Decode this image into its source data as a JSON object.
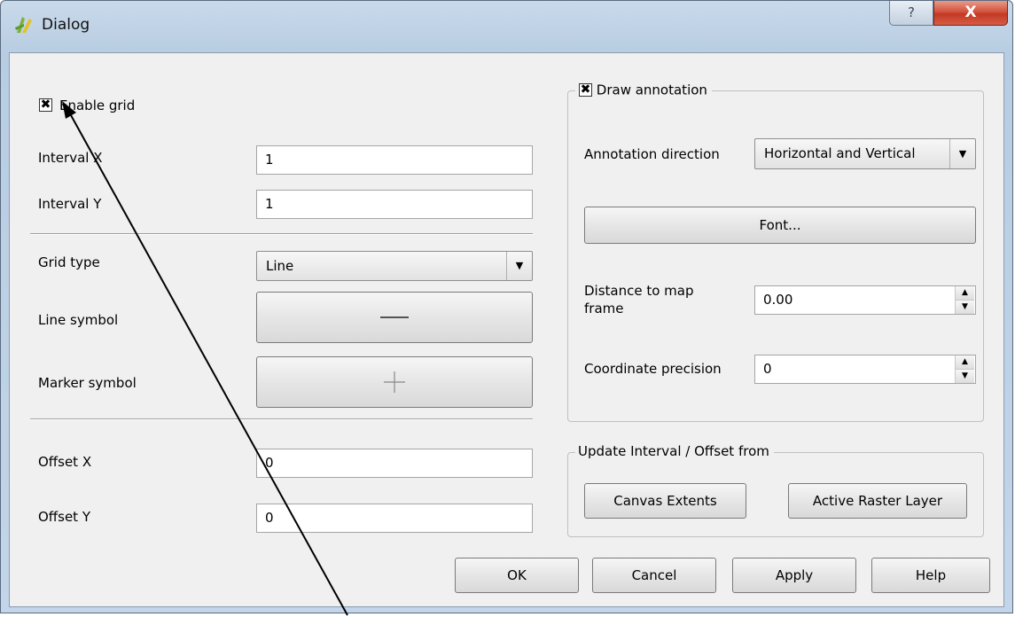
{
  "window": {
    "title": "Dialog",
    "help_glyph": "?",
    "close_glyph": "X"
  },
  "left": {
    "enable_grid": {
      "label": "Enable grid",
      "checked": true,
      "mark": "✖"
    },
    "interval_x": {
      "label": "Interval X",
      "value": "1"
    },
    "interval_y": {
      "label": "Interval Y",
      "value": "1"
    },
    "grid_type": {
      "label": "Grid type",
      "value": "Line"
    },
    "line_symbol": {
      "label": "Line symbol"
    },
    "marker_symbol": {
      "label": "Marker symbol"
    },
    "offset_x": {
      "label": "Offset X",
      "value": "0"
    },
    "offset_y": {
      "label": "Offset Y",
      "value": "0"
    }
  },
  "annotation": {
    "group_label": "Draw annotation",
    "checked": true,
    "mark": "✖",
    "direction_label": "Annotation direction",
    "direction_value": "Horizontal and Vertical",
    "font_button": "Font...",
    "distance_label_line1": "Distance to map",
    "distance_label_line2": "frame",
    "distance_value": "0.00",
    "precision_label": "Coordinate precision",
    "precision_value": "0"
  },
  "update_group": {
    "label": "Update Interval / Offset from",
    "canvas_extents": "Canvas Extents",
    "active_raster": "Active Raster Layer"
  },
  "buttons": {
    "ok": "OK",
    "cancel": "Cancel",
    "apply": "Apply",
    "help": "Help"
  },
  "icons": {
    "dropdown": "▼",
    "spin_up": "▲",
    "spin_down": "▼"
  },
  "colors": {
    "title_bar": "#c3d5e8",
    "close_button": "#c23a24",
    "dialog_bg": "#f0f0f0"
  }
}
